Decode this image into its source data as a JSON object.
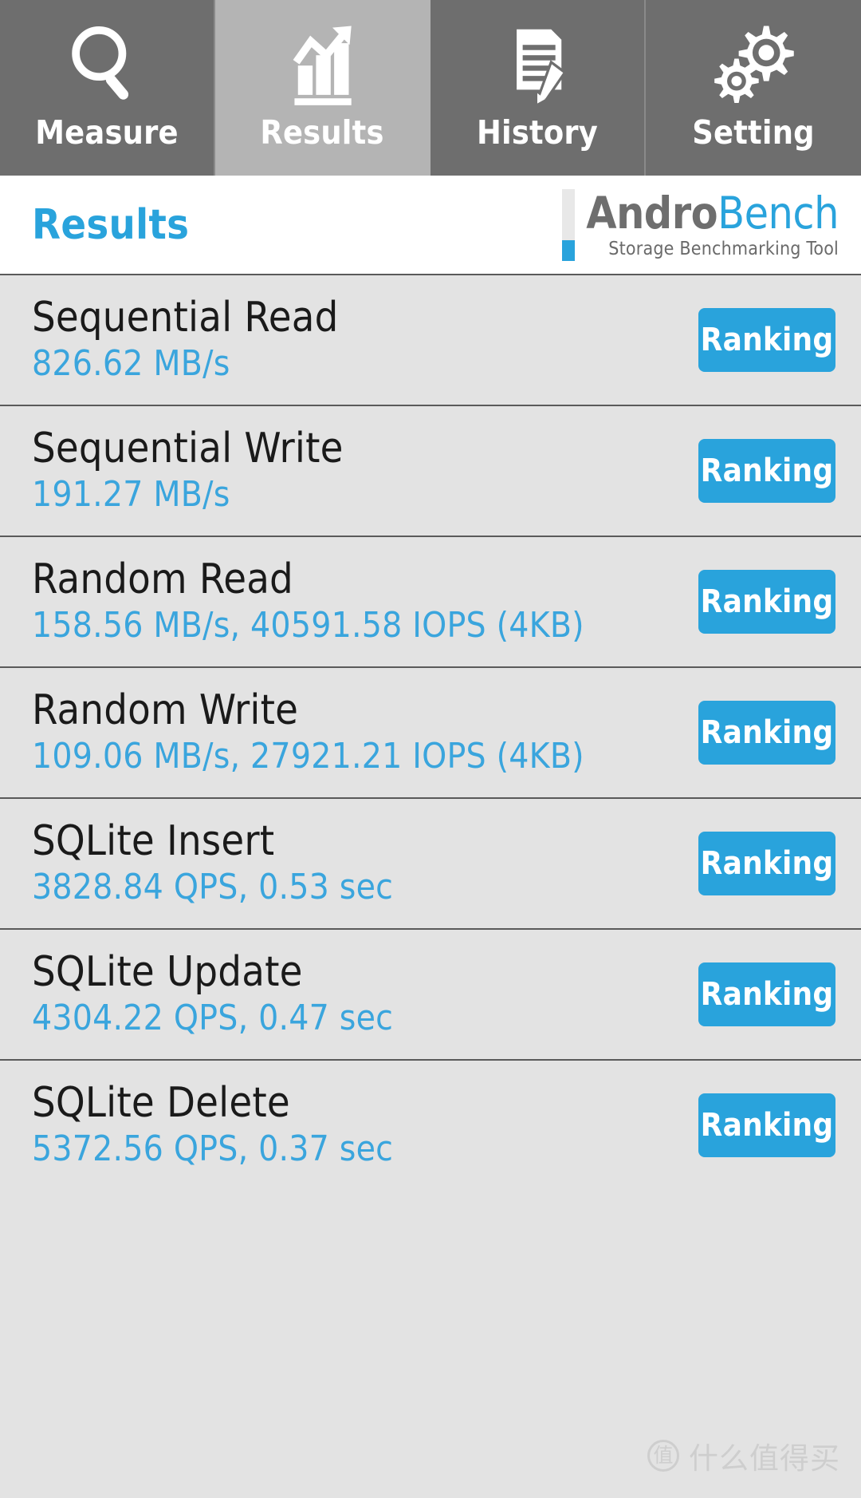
{
  "app": {
    "brand_name_part1": "Andro",
    "brand_name_part2": "Bench",
    "brand_tagline": "Storage Benchmarking Tool",
    "accent_color": "#29a3dc",
    "tab_active_bg": "#b4b4b4",
    "tab_bg": "#6e6e6e",
    "list_bg": "#e3e3e3"
  },
  "tabs": [
    {
      "label": "Measure",
      "icon": "magnifier-icon",
      "active": false
    },
    {
      "label": "Results",
      "icon": "bar-chart-icon",
      "active": true
    },
    {
      "label": "History",
      "icon": "document-pencil-icon",
      "active": false
    },
    {
      "label": "Setting",
      "icon": "gears-icon",
      "active": false
    }
  ],
  "header": {
    "title": "Results"
  },
  "results": {
    "ranking_label": "Ranking",
    "rows": [
      {
        "title": "Sequential Read",
        "value": "826.62 MB/s"
      },
      {
        "title": "Sequential Write",
        "value": "191.27 MB/s"
      },
      {
        "title": "Random Read",
        "value": "158.56 MB/s, 40591.58 IOPS (4KB)"
      },
      {
        "title": "Random Write",
        "value": "109.06 MB/s, 27921.21 IOPS (4KB)"
      },
      {
        "title": "SQLite Insert",
        "value": "3828.84 QPS, 0.53 sec"
      },
      {
        "title": "SQLite Update",
        "value": "4304.22 QPS, 0.47 sec"
      },
      {
        "title": "SQLite Delete",
        "value": "5372.56 QPS, 0.37 sec"
      }
    ]
  },
  "watermark": {
    "badge": "值",
    "text": "什么值得买"
  }
}
